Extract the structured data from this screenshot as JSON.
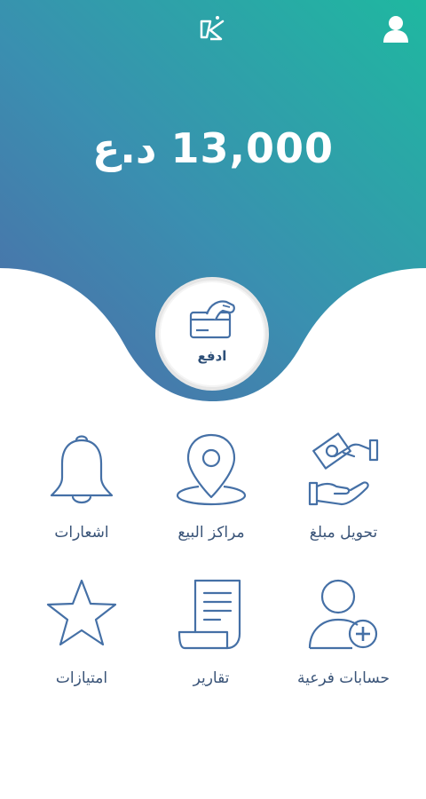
{
  "header": {
    "logo_icon": "brand-logo-icon",
    "profile_icon": "user-profile-icon"
  },
  "balance": {
    "amount": "13,000",
    "currency": "د.ع"
  },
  "pay": {
    "label": "ادفع",
    "icon": "card-payment-icon"
  },
  "menu": [
    {
      "label": "تحويل مبلغ",
      "icon": "money-transfer-icon"
    },
    {
      "label": "مراكز البيع",
      "icon": "location-pin-icon"
    },
    {
      "label": "اشعارات",
      "icon": "bell-icon"
    },
    {
      "label": "حسابات فرعية",
      "icon": "add-user-icon"
    },
    {
      "label": "تقارير",
      "icon": "receipt-icon"
    },
    {
      "label": "امتيازات",
      "icon": "star-icon"
    }
  ],
  "colors": {
    "gradient_top": "#1fb5a0",
    "gradient_bottom": "#4a73ad",
    "icon_stroke": "#4570a6",
    "label_text": "#3a5478"
  }
}
